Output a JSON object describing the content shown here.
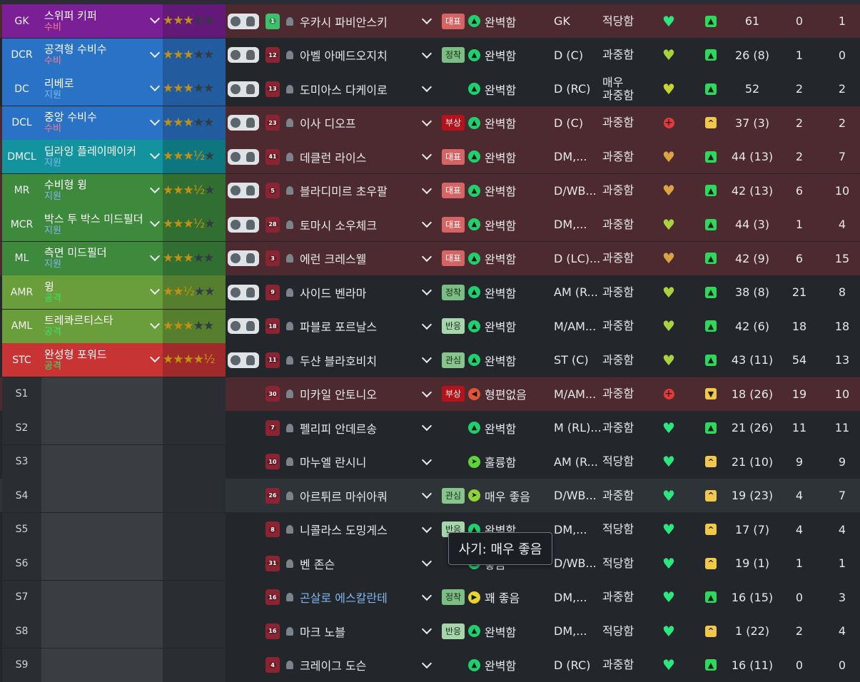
{
  "colors": {
    "red_row": "#4d2a2f",
    "dark_row": "#23272c",
    "highlight_row": "#2e3338",
    "star_on": "#f2b416",
    "form_green": "#1fd06f",
    "status_green": "#2fd85c",
    "status_yellow": "#f2c84b",
    "heart_green": "#2ee67e"
  },
  "tooltip": {
    "text": "사기: 매우 좋음"
  },
  "rows": [
    {
      "pos": "GK",
      "pos_bg": "#7a1f96",
      "role": "스위퍼 키퍼",
      "duty": "수비",
      "duty_color": "#ff7b8f",
      "stars": "★★★",
      "stars_off": "★★",
      "stripe": "#7a1f96",
      "shirt_color": "#3ebf6b",
      "number": "1",
      "name": "우카시 파비안스키",
      "flag": "대표",
      "flag_type": "rep",
      "form_icon": "check",
      "form": "완벽함",
      "form_color": "#1fd06f",
      "position": "GK",
      "condition": "적당함",
      "heart": "♥",
      "heart_color": "#2ee67e",
      "status": "up",
      "status_color": "#2fd85c",
      "apps": "61",
      "goals": "0",
      "assists": "1",
      "row_type": "red"
    },
    {
      "pos": "DCR",
      "pos_bg": "#2a72c6",
      "role": "공격형 수비수",
      "duty": "수비",
      "duty_color": "#ff7b8f",
      "stars": "★★★",
      "stars_off": "★★",
      "stripe": "#2a72c6",
      "shirt_color": "#8a2432",
      "number": "12",
      "name": "아벨 아메드오지치",
      "flag": "정착",
      "flag_type": "settled",
      "form_icon": "check",
      "form": "완벽함",
      "form_color": "#1fd06f",
      "position": "D (C)",
      "condition": "과중함",
      "heart": "♥",
      "heart_color": "#a8d23e",
      "status": "up",
      "status_color": "#2fd85c",
      "apps": "26 (8)",
      "goals": "1",
      "assists": "0",
      "row_type": "dark"
    },
    {
      "pos": "DC",
      "pos_bg": "#2a72c6",
      "role": "리베로",
      "duty": "지원",
      "duty_color": "#7fb6ec",
      "stars": "★★★",
      "stars_off": "★★",
      "stripe": "#2a72c6",
      "shirt_color": "#8a2432",
      "number": "13",
      "name": "도미아스 다케이로",
      "flag": "",
      "flag_type": "",
      "form_icon": "check",
      "form": "완벽함",
      "form_color": "#1fd06f",
      "position": "D (RC)",
      "condition": "매우\n과중함",
      "heart": "♥",
      "heart_color": "#c7d534",
      "status": "up",
      "status_color": "#2fd85c",
      "apps": "52",
      "goals": "2",
      "assists": "2",
      "row_type": "dark"
    },
    {
      "pos": "DCL",
      "pos_bg": "#2a72c6",
      "role": "중앙 수비수",
      "duty": "수비",
      "duty_color": "#ff7b8f",
      "stars": "★★★",
      "stars_off": "★★",
      "stripe": "#2a72c6",
      "shirt_color": "#8a2432",
      "number": "23",
      "name": "이사 디오프",
      "flag": "부상",
      "flag_type": "inj",
      "form_icon": "check",
      "form": "완벽함",
      "form_color": "#1fd06f",
      "position": "D (C)",
      "condition": "과중함",
      "heart": "+",
      "heart_color": "#e03a3a",
      "status": "caret",
      "status_color": "#f2c84b",
      "apps": "37 (3)",
      "goals": "2",
      "assists": "2",
      "row_type": "red"
    },
    {
      "pos": "DMCL",
      "pos_bg": "#12939e",
      "role": "딥라잉 플레이메이커",
      "duty": "지원",
      "duty_color": "#7fb6ec",
      "stars": "★★★½",
      "stars_off": "★",
      "stripe": "#12939e",
      "shirt_color": "#8a2432",
      "number": "41",
      "name": "데클런 라이스",
      "flag": "대표",
      "flag_type": "rep",
      "form_icon": "check",
      "form": "완벽함",
      "form_color": "#1fd06f",
      "position": "DM,...",
      "condition": "과중함",
      "heart": "♥",
      "heart_color": "#d9a441",
      "status": "up",
      "status_color": "#2fd85c",
      "apps": "44 (13)",
      "goals": "2",
      "assists": "7",
      "row_type": "red"
    },
    {
      "pos": "MR",
      "pos_bg": "#3d8a3d",
      "role": "수비형 윙",
      "duty": "지원",
      "duty_color": "#7fb6ec",
      "stars": "★★★½",
      "stars_off": "★",
      "stripe": "#3d8a3d",
      "shirt_color": "#8a2432",
      "number": "5",
      "name": "블라디미르 초우팔",
      "flag": "대표",
      "flag_type": "rep",
      "form_icon": "check",
      "form": "완벽함",
      "form_color": "#1fd06f",
      "position": "D/WB...",
      "condition": "과중함",
      "heart": "♥",
      "heart_color": "#d9a441",
      "status": "up",
      "status_color": "#2fd85c",
      "apps": "42 (13)",
      "goals": "6",
      "assists": "10",
      "row_type": "red"
    },
    {
      "pos": "MCR",
      "pos_bg": "#3d8a3d",
      "role": "박스 투 박스 미드필더",
      "duty": "지원",
      "duty_color": "#7fb6ec",
      "stars": "★★★½",
      "stars_off": "★",
      "stripe": "#3d8a3d",
      "shirt_color": "#8a2432",
      "number": "28",
      "name": "토마시 소우체크",
      "flag": "대표",
      "flag_type": "rep",
      "form_icon": "check",
      "form": "완벽함",
      "form_color": "#1fd06f",
      "position": "DM,...",
      "condition": "과중함",
      "heart": "♥",
      "heart_color": "#a8d23e",
      "status": "up",
      "status_color": "#2fd85c",
      "apps": "44 (3)",
      "goals": "1",
      "assists": "4",
      "row_type": "red"
    },
    {
      "pos": "ML",
      "pos_bg": "#3d8a3d",
      "role": "측면 미드필더",
      "duty": "지원",
      "duty_color": "#7fb6ec",
      "stars": "★★★",
      "stars_off": "★★",
      "stripe": "#3d8a3d",
      "shirt_color": "#8a2432",
      "number": "3",
      "name": "에런 크레스웰",
      "flag": "대표",
      "flag_type": "rep",
      "form_icon": "check",
      "form": "완벽함",
      "form_color": "#1fd06f",
      "position": "D (LC)...",
      "condition": "과중함",
      "heart": "♥",
      "heart_color": "#d9a441",
      "status": "up",
      "status_color": "#2fd85c",
      "apps": "42 (9)",
      "goals": "6",
      "assists": "15",
      "row_type": "red"
    },
    {
      "pos": "AMR",
      "pos_bg": "#6a9e3a",
      "role": "윙",
      "duty": "공격",
      "duty_color": "#3ee06a",
      "stars": "★★½",
      "stars_off": "★★",
      "stripe": "#6a9e3a",
      "shirt_color": "#8a2432",
      "number": "9",
      "name": "사이드 벤라마",
      "flag": "정착",
      "flag_type": "settled",
      "form_icon": "check",
      "form": "완벽함",
      "form_color": "#1fd06f",
      "position": "AM (R...",
      "condition": "과중함",
      "heart": "♥",
      "heart_color": "#a8d23e",
      "status": "up",
      "status_color": "#2fd85c",
      "apps": "38 (8)",
      "goals": "21",
      "assists": "8",
      "row_type": "dark"
    },
    {
      "pos": "AML",
      "pos_bg": "#6a9e3a",
      "role": "트레콰르티스타",
      "duty": "공격",
      "duty_color": "#3ee06a",
      "stars": "★★★",
      "stars_off": "★★",
      "stripe": "#6a9e3a",
      "shirt_color": "#8a2432",
      "number": "18",
      "name": "파블로 포르날스",
      "flag": "반응",
      "flag_type": "react",
      "form_icon": "check",
      "form": "완벽함",
      "form_color": "#1fd06f",
      "position": "M/AM...",
      "condition": "과중함",
      "heart": "♥",
      "heart_color": "#a8d23e",
      "status": "up",
      "status_color": "#2fd85c",
      "apps": "42 (6)",
      "goals": "18",
      "assists": "18",
      "row_type": "dark"
    },
    {
      "pos": "STC",
      "pos_bg": "#c83434",
      "role": "완성형 포워드",
      "duty": "공격",
      "duty_color": "#3ee06a",
      "stars": "★★★★½",
      "stars_off": "",
      "stripe": "#c83434",
      "shirt_color": "#8a2432",
      "number": "11",
      "name": "두샨 블라호비치",
      "flag": "관심",
      "flag_type": "conc",
      "form_icon": "check",
      "form": "완벽함",
      "form_color": "#1fd06f",
      "position": "ST (C)",
      "condition": "과중함",
      "heart": "♥",
      "heart_color": "#a8d23e",
      "status": "up",
      "status_color": "#2fd85c",
      "apps": "43 (11)",
      "goals": "54",
      "assists": "13",
      "row_type": "dark"
    },
    {
      "pos": "S1",
      "pos_bg": "",
      "role": "",
      "duty": "",
      "duty_color": "",
      "stars": "",
      "stars_off": "",
      "stripe": "",
      "shirt_color": "#8a2432",
      "number": "30",
      "name": "미카일 안토니오",
      "flag": "부상",
      "flag_type": "inj",
      "form_icon": "left",
      "form": "형편없음",
      "form_color": "#e0553a",
      "position": "M/AM...",
      "condition": "과중함",
      "heart": "+",
      "heart_color": "#e03a3a",
      "status": "down",
      "status_color": "#f2c84b",
      "apps": "18 (26)",
      "goals": "19",
      "assists": "10",
      "row_type": "red"
    },
    {
      "pos": "S2",
      "pos_bg": "",
      "role": "",
      "duty": "",
      "duty_color": "",
      "stars": "",
      "stars_off": "",
      "stripe": "",
      "shirt_color": "#8a2432",
      "number": "7",
      "name": "펠리피 안데르송",
      "flag": "",
      "flag_type": "",
      "form_icon": "check",
      "form": "완벽함",
      "form_color": "#1fd06f",
      "position": "M (RL)...",
      "condition": "과중함",
      "heart": "♥",
      "heart_color": "#2ee67e",
      "status": "up",
      "status_color": "#2fd85c",
      "apps": "21 (26)",
      "goals": "11",
      "assists": "11",
      "row_type": "dark"
    },
    {
      "pos": "S3",
      "pos_bg": "",
      "role": "",
      "duty": "",
      "duty_color": "",
      "stars": "",
      "stars_off": "",
      "stripe": "",
      "shirt_color": "#8a2432",
      "number": "10",
      "name": "마누엘 란시니",
      "flag": "",
      "flag_type": "",
      "form_icon": "diag",
      "form": "훌륭함",
      "form_color": "#5ed33a",
      "position": "AM (R...",
      "condition": "적당함",
      "heart": "♥",
      "heart_color": "#2ee67e",
      "status": "caret",
      "status_color": "#f2c84b",
      "apps": "21 (10)",
      "goals": "9",
      "assists": "9",
      "row_type": "dark"
    },
    {
      "pos": "S4",
      "pos_bg": "",
      "role": "",
      "duty": "",
      "duty_color": "",
      "stars": "",
      "stars_off": "",
      "stripe": "",
      "shirt_color": "#8a2432",
      "number": "26",
      "name": "아르튀르 마쉬아쿼",
      "flag": "관심",
      "flag_type": "conc",
      "form_icon": "diag",
      "form": "매우 좋음",
      "form_color": "#8ed33a",
      "position": "D/WB...",
      "condition": "과중함",
      "heart": "♥",
      "heart_color": "#2ee67e",
      "status": "caret",
      "status_color": "#f2c84b",
      "apps": "19 (23)",
      "goals": "4",
      "assists": "7",
      "row_type": "hl"
    },
    {
      "pos": "S5",
      "pos_bg": "",
      "role": "",
      "duty": "",
      "duty_color": "",
      "stars": "",
      "stars_off": "",
      "stripe": "",
      "shirt_color": "#8a2432",
      "number": "8",
      "name": "니콜라스 도밍게스",
      "flag": "반응",
      "flag_type": "react",
      "form_icon": "check",
      "form": "완벽함",
      "form_color": "#1fd06f",
      "position": "DM,...",
      "condition": "적당함",
      "heart": "♥",
      "heart_color": "#2ee67e",
      "status": "caret",
      "status_color": "#f2c84b",
      "apps": "17 (7)",
      "goals": "4",
      "assists": "4",
      "row_type": "dark"
    },
    {
      "pos": "S6",
      "pos_bg": "",
      "role": "",
      "duty": "",
      "duty_color": "",
      "stars": "",
      "stars_off": "",
      "stripe": "",
      "shirt_color": "#8a2432",
      "number": "31",
      "name": "벤 존슨",
      "flag": "",
      "flag_type": "",
      "form_icon": "check",
      "form": "좋음",
      "form_color": "#1fd06f",
      "position": "D/WB...",
      "condition": "적당함",
      "heart": "♥",
      "heart_color": "#2ee67e",
      "status": "caret",
      "status_color": "#f2c84b",
      "apps": "19 (1)",
      "goals": "1",
      "assists": "1",
      "row_type": "dark"
    },
    {
      "pos": "S7",
      "pos_bg": "",
      "role": "",
      "duty": "",
      "duty_color": "",
      "stars": "",
      "stars_off": "",
      "stripe": "",
      "shirt_color": "#8a2432",
      "number": "16",
      "name": "곤살로 에스칼란테",
      "name_color": "#7fb6ec",
      "flag": "정착",
      "flag_type": "settled",
      "form_icon": "right",
      "form": "꽤 좋음",
      "form_color": "#e8d42e",
      "position": "DM,...",
      "condition": "과중함",
      "heart": "♥",
      "heart_color": "#2ee67e",
      "status": "up",
      "status_color": "#2fd85c",
      "apps": "16 (15)",
      "goals": "0",
      "assists": "3",
      "row_type": "dark"
    },
    {
      "pos": "S8",
      "pos_bg": "",
      "role": "",
      "duty": "",
      "duty_color": "",
      "stars": "",
      "stars_off": "",
      "stripe": "",
      "shirt_color": "#8a2432",
      "number": "16",
      "name": "마크 노블",
      "flag": "반응",
      "flag_type": "react",
      "form_icon": "check",
      "form": "완벽함",
      "form_color": "#1fd06f",
      "position": "DM,...",
      "condition": "적당함",
      "heart": "♥",
      "heart_color": "#2ee67e",
      "status": "caret",
      "status_color": "#f2c84b",
      "apps": "1 (22)",
      "goals": "2",
      "assists": "4",
      "row_type": "dark"
    },
    {
      "pos": "S9",
      "pos_bg": "",
      "role": "",
      "duty": "",
      "duty_color": "",
      "stars": "",
      "stars_off": "",
      "stripe": "",
      "shirt_color": "#8a2432",
      "number": "4",
      "name": "크레이그 도슨",
      "flag": "",
      "flag_type": "",
      "form_icon": "check",
      "form": "완벽함",
      "form_color": "#1fd06f",
      "position": "D (RC)",
      "condition": "과중함",
      "heart": "♥",
      "heart_color": "#2ee67e",
      "status": "up",
      "status_color": "#2fd85c",
      "apps": "16 (11)",
      "goals": "0",
      "assists": "0",
      "row_type": "dark"
    }
  ]
}
